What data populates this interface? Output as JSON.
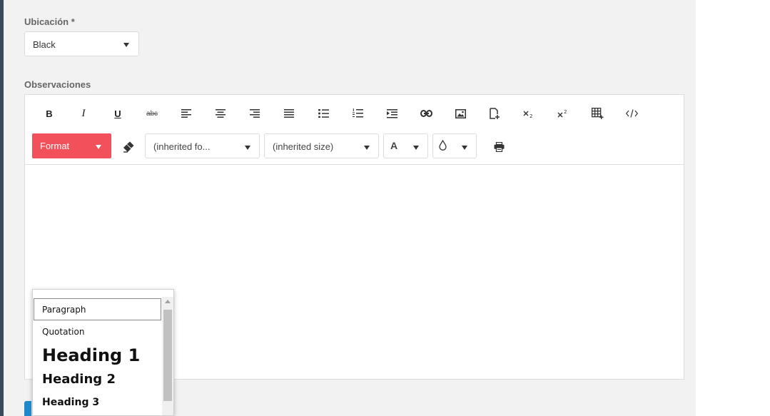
{
  "form": {
    "ubicacion": {
      "label": "Ubicación *",
      "value": "Black"
    },
    "observaciones": {
      "label": "Observaciones"
    }
  },
  "toolbar": {
    "bold": "B",
    "italic": "I",
    "underline": "U",
    "strikethrough": "abc",
    "format_label": "Format",
    "font_family": "(inherited fo...",
    "font_size": "(inherited size)",
    "text_color_label": "A",
    "icons": [
      "bold",
      "italic",
      "underline",
      "strikethrough",
      "align-left-icon",
      "align-center-icon",
      "align-right-icon",
      "align-justify-icon",
      "unordered-list-icon",
      "ordered-list-icon",
      "indent-icon",
      "link-icon",
      "image-icon",
      "new-document-icon",
      "subscript-icon",
      "superscript-icon",
      "table-icon",
      "code-view-icon",
      "eraser-icon",
      "color-drop-icon",
      "print-icon"
    ]
  },
  "format_menu": {
    "items": [
      "Paragraph",
      "Quotation",
      "Heading 1",
      "Heading 2",
      "Heading 3"
    ],
    "selected": "Paragraph"
  },
  "colors": {
    "accent": "#f2505a",
    "panel_bg": "#f2f2f2",
    "sidebar": "#3b4a5a",
    "primary_button": "#1e88c8"
  }
}
